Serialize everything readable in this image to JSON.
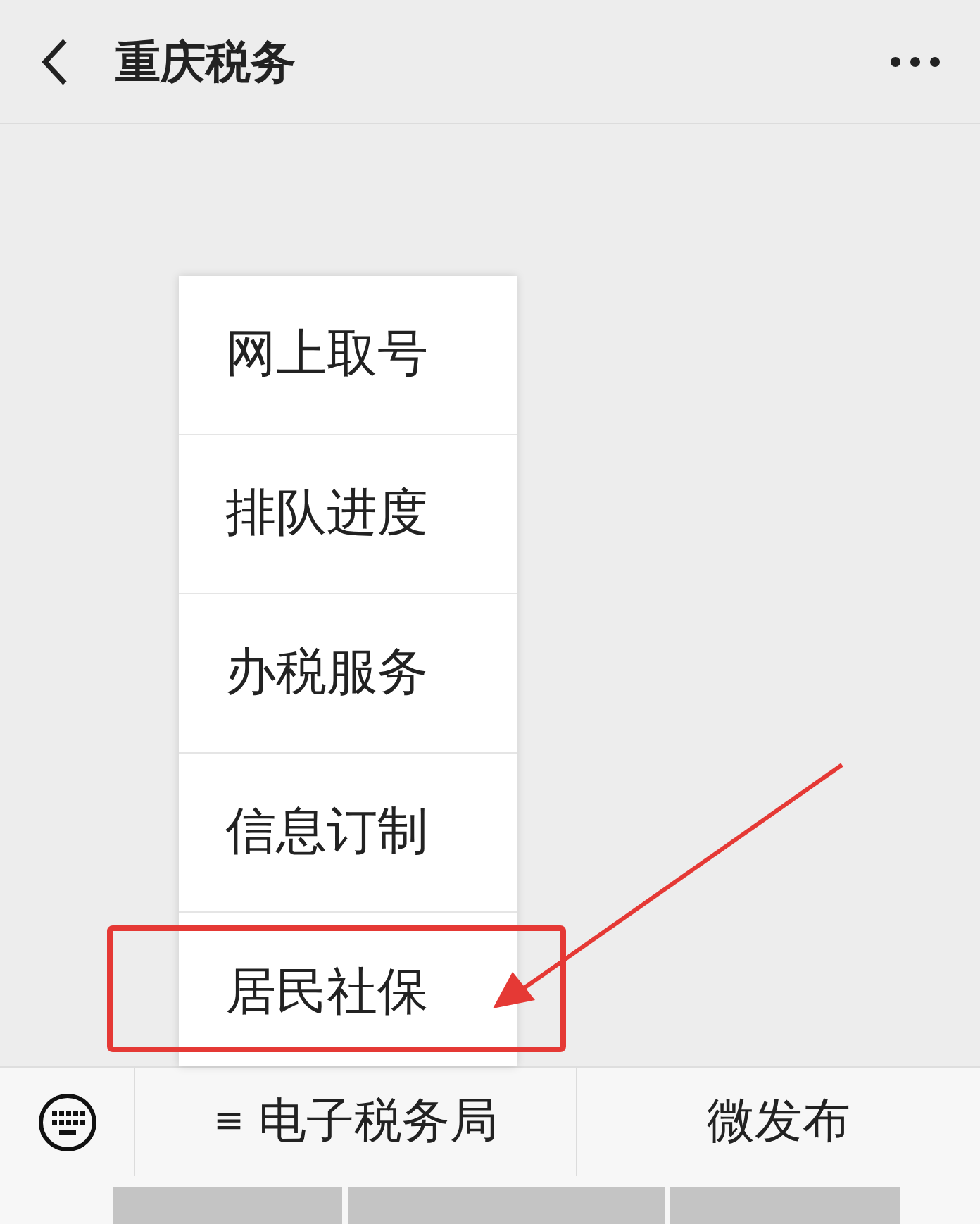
{
  "header": {
    "title": "重庆税务"
  },
  "popup_menu": {
    "items": [
      {
        "label": "网上取号"
      },
      {
        "label": "排队进度"
      },
      {
        "label": "办税服务"
      },
      {
        "label": "信息订制"
      },
      {
        "label": "居民社保"
      }
    ]
  },
  "bottom_menu": {
    "items": [
      {
        "icon": "≡",
        "label": "电子税务局"
      },
      {
        "label": "微发布"
      }
    ]
  }
}
